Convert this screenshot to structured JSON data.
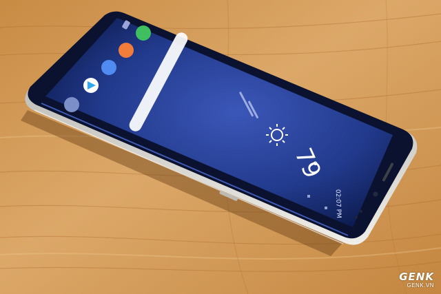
{
  "photo": {
    "subject": "smartphone-on-wooden-table",
    "colors": {
      "wood_light": "#e0b173",
      "wood_dark": "#b87a35",
      "phone_frame": "#d7d5cf",
      "screen_edge": "#0b1a4d",
      "screen_center": "#2d46a3",
      "accent_blue": "#5578e8"
    }
  },
  "screen": {
    "weather": {
      "temperature": "79",
      "degree_symbol": "°",
      "condition_icon": "sun-icon"
    },
    "status_bar": {
      "time": "02:07 PM"
    },
    "app_icons": [
      "phone-icon",
      "camera-icon",
      "settings-icon",
      "play-store-icon",
      "gallery-icon",
      "chat-icon"
    ]
  },
  "watermark": {
    "logo": "GENK",
    "site": "GENK.VN"
  }
}
